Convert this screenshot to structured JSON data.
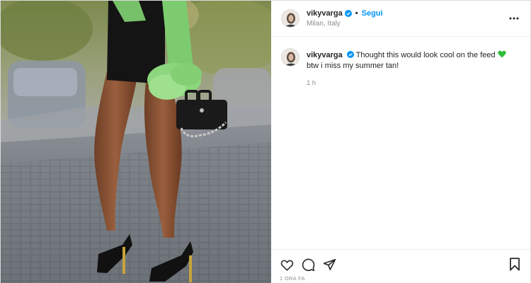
{
  "post": {
    "image_alt": "Photo by vikyvarga",
    "header": {
      "username": "vikyvarga",
      "separator": "•",
      "follow_label": "Segui",
      "location": "Milan, Italy",
      "avatar_icon": "avatar-photo-icon",
      "verified_icon": "verified-badge-icon",
      "more_icon": "more-options-icon",
      "verified_color": "#0095f6"
    },
    "caption": {
      "username": "vikyvarga",
      "text_before": "Thought this would look cool on the feed",
      "emoji_icon": "green-heart-icon",
      "text_after": "btw i miss my summer tan!",
      "time": "1 h"
    },
    "actions": {
      "like_icon": "heart-outline-icon",
      "comment_icon": "comment-icon",
      "share_icon": "share-send-icon",
      "save_icon": "bookmark-icon"
    },
    "posted_time": "1 ORA FA",
    "colors": {
      "accent": "#0095f6",
      "muted": "#8e8e8e",
      "text": "#262626",
      "green_heart": "#2ebd3b"
    }
  }
}
